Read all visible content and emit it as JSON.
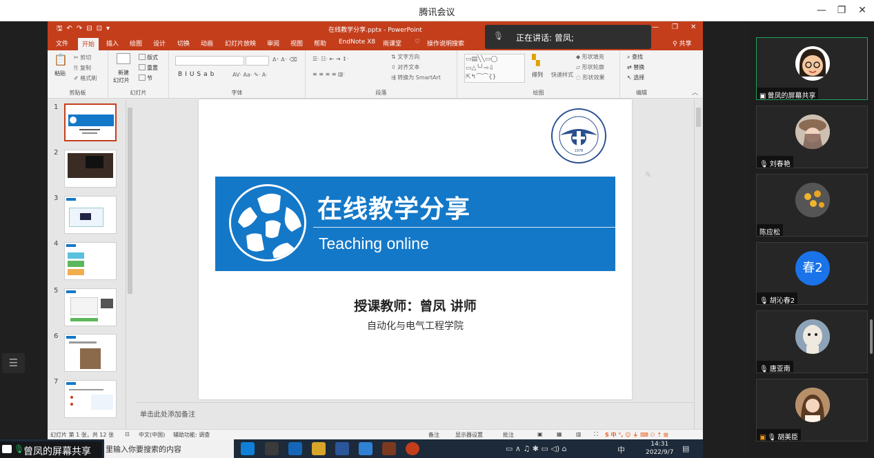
{
  "app": {
    "window_title": "腾讯会议"
  },
  "ppt": {
    "doc_title": "在线教学分享.pptx - PowerPoint",
    "tabs": [
      "文件",
      "开始",
      "插入",
      "绘图",
      "设计",
      "切换",
      "动画",
      "幻灯片放映",
      "审阅",
      "视图",
      "帮助",
      "EndNote X8",
      "雨课堂",
      "操作说明搜索"
    ],
    "share_label": "共享",
    "ribbon": {
      "clipboard": {
        "paste": "粘贴",
        "cut": "剪切",
        "copy": "复制",
        "format_painter": "格式刷",
        "group": "剪贴板"
      },
      "slides": {
        "new_slide_l1": "新建",
        "new_slide_l2": "幻灯片",
        "layout": "版式",
        "reset": "重置",
        "section": "节",
        "group": "幻灯片"
      },
      "font": {
        "group": "字体"
      },
      "paragraph": {
        "text_direction": "文字方向",
        "align_text": "对齐文本",
        "smartart": "转换为 SmartArt",
        "group": "段落"
      },
      "drawing": {
        "arrange": "排列",
        "quick_styles": "快速样式",
        "shape_fill": "形状填充",
        "shape_outline": "形状轮廓",
        "shape_effects": "形状效果",
        "group": "绘图"
      },
      "editing": {
        "find": "查找",
        "replace": "替换",
        "select": "选择",
        "group": "编辑"
      }
    },
    "thumbnails": [
      "1",
      "2",
      "3",
      "4",
      "5",
      "6",
      "7"
    ],
    "slide": {
      "title_cn": "在线教学分享",
      "title_en": "Teaching online",
      "teacher": "授课教师：曾凤  讲师",
      "college": "自动化与电气工程学院",
      "seal_text": "Changzhou Technological University"
    },
    "notes_placeholder": "单击此处添加备注",
    "status": {
      "slide_count": "幻灯片 第 1 张，共 12 张",
      "language": "中文(中国)",
      "accessibility": "辅助功能: 调查",
      "notes": "备注",
      "display_settings": "显示器设置",
      "comments": "批注"
    }
  },
  "speaking": {
    "label": "正在讲话: 曾凤;"
  },
  "taskbar": {
    "share_badge": "曾凤的屏幕共享",
    "search_placeholder": "里输入你要搜索的内容",
    "ime": "中",
    "time": "14:31",
    "date": "2022/9/7"
  },
  "participants": [
    {
      "name": "曾凤的屏幕共享",
      "avatar": "cartoon-woman"
    },
    {
      "name": "刘春艳",
      "avatar": "photo-woman-hat"
    },
    {
      "name": "陈应松",
      "avatar": "photo-yellow-flowers"
    },
    {
      "name": "胡沁春2",
      "avatar_text": "春2",
      "avatar_color": "#1a73e8"
    },
    {
      "name": "唐亚南",
      "avatar": "photo-alpaca"
    },
    {
      "name": "胡美臣",
      "avatar": "photo-woman"
    }
  ],
  "colors": {
    "ppt_accent": "#c43e1c",
    "slide_blue": "#1478c8",
    "active_green": "#1fa35c"
  }
}
